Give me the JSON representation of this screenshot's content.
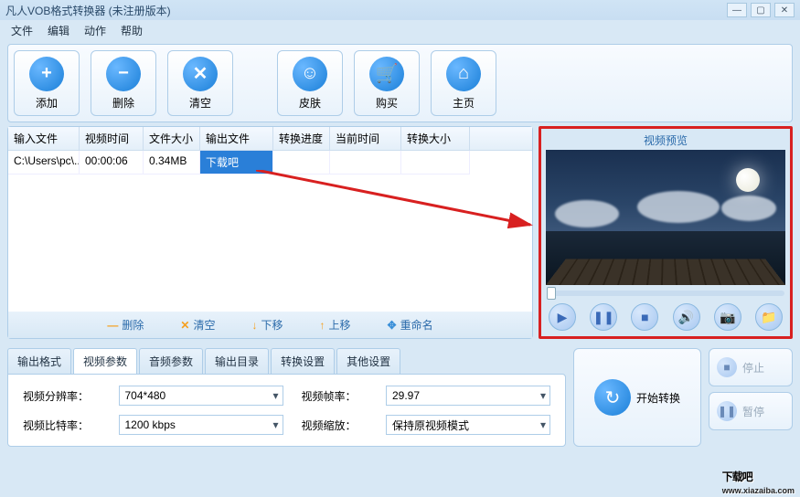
{
  "window": {
    "title": "凡人VOB格式转换器  (未注册版本)"
  },
  "menu": {
    "file": "文件",
    "edit": "编辑",
    "action": "动作",
    "help": "帮助"
  },
  "toolbar": {
    "add": "添加",
    "delete": "删除",
    "clear": "清空",
    "skin": "皮肤",
    "buy": "购买",
    "home": "主页"
  },
  "table": {
    "headers": {
      "input": "输入文件",
      "vtime": "视频时间",
      "fsize": "文件大小",
      "output": "输出文件",
      "progress": "转换进度",
      "curtime": "当前时间",
      "csize": "转换大小"
    },
    "rows": [
      {
        "input": "C:\\Users\\pc\\..",
        "vtime": "00:00:06",
        "fsize": "0.34MB",
        "output": "下载吧",
        "progress": "",
        "curtime": "",
        "csize": ""
      }
    ]
  },
  "list_actions": {
    "delete": "删除",
    "clear": "清空",
    "down": "下移",
    "up": "上移",
    "rename": "重命名"
  },
  "preview": {
    "title": "视频预览"
  },
  "tabs": {
    "t0": "输出格式",
    "t1": "视频参数",
    "t2": "音频参数",
    "t3": "输出目录",
    "t4": "转换设置",
    "t5": "其他设置"
  },
  "settings": {
    "resolution_label": "视频分辨率：",
    "resolution": "704*480",
    "fps_label": "视频帧率：",
    "fps": "29.97",
    "bitrate_label": "视频比特率：",
    "bitrate": "1200 kbps",
    "scale_label": "视频缩放：",
    "scale": "保持原视频模式"
  },
  "actions": {
    "start": "开始转换",
    "stop": "停止",
    "pause": "暂停"
  },
  "watermark": {
    "brand": "下载吧",
    "url": "www.xiazaiba.com"
  }
}
